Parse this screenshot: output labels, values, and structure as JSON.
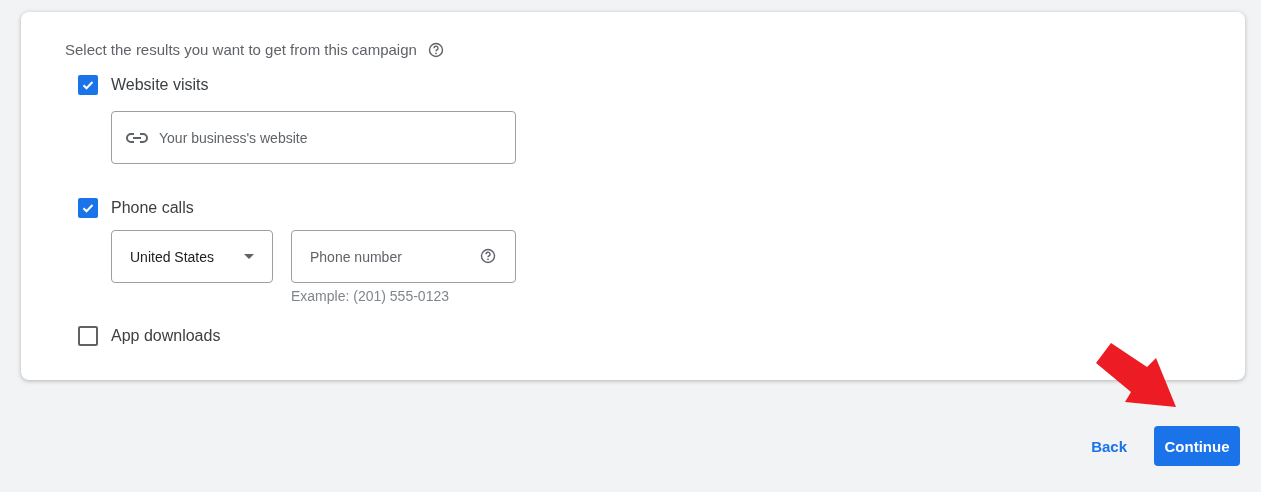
{
  "heading": "Select the results you want to get from this campaign",
  "options": [
    {
      "kind": "website",
      "label": "Website visits",
      "checked": true,
      "placeholder": "Your business's website"
    },
    {
      "kind": "phone",
      "label": "Phone calls",
      "checked": true,
      "country": "United States",
      "placeholder": "Phone number",
      "hint": "Example: (201) 555-0123"
    },
    {
      "kind": "plain",
      "label": "App downloads",
      "checked": false
    }
  ],
  "buttons": {
    "back": "Back",
    "continue": "Continue"
  }
}
